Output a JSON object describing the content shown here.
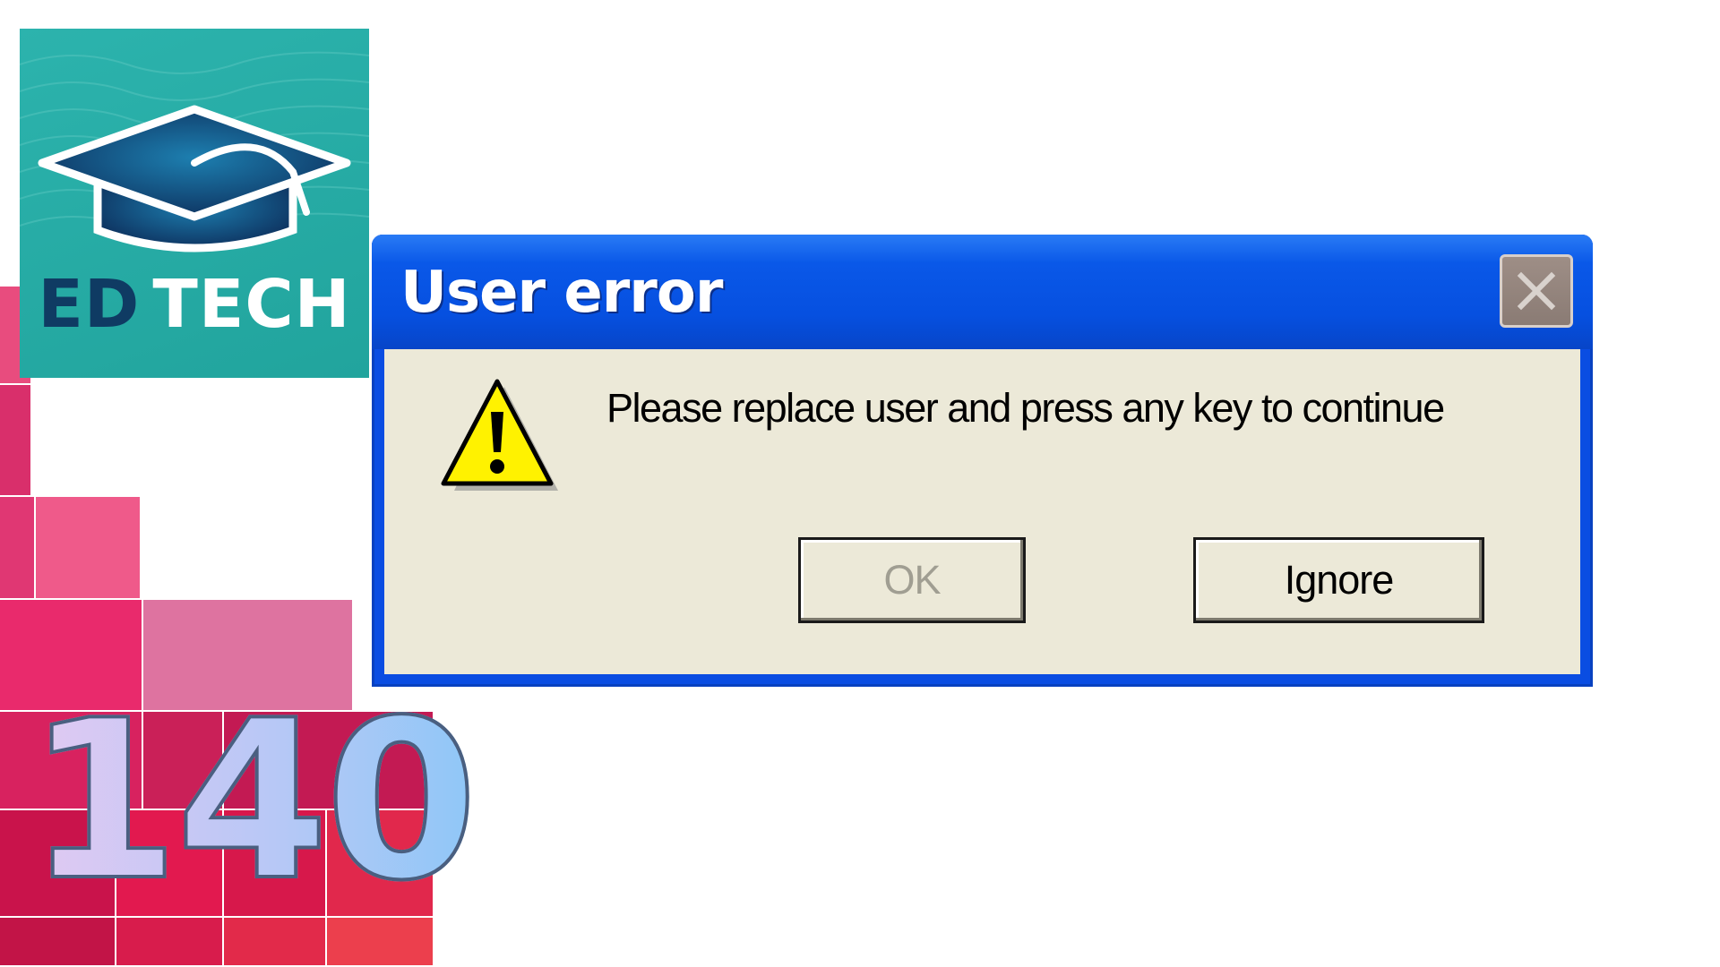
{
  "logo": {
    "text_ed": "ED",
    "text_tech": "TECH",
    "icon": "graduation-cap-icon",
    "background_color": "#24a9a2"
  },
  "episode": {
    "number": "140"
  },
  "dialog": {
    "title": "User error",
    "close_icon": "close-icon",
    "warning_icon": "warning-icon",
    "message": "Please replace user and press any key to continue",
    "buttons": {
      "ok_label": "OK",
      "ok_state": "disabled",
      "ignore_label": "Ignore"
    },
    "colors": {
      "titlebar": "#0a58e8",
      "client": "#ece9d8",
      "close_button": "#9a8b84"
    }
  }
}
